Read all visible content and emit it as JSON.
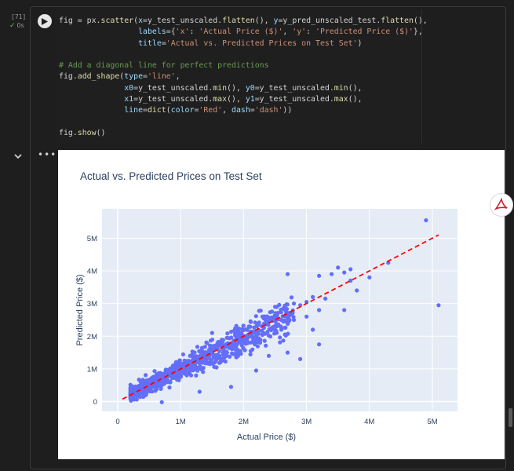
{
  "cell": {
    "execution_count": "[71]",
    "status_check": "✓",
    "status_time": "0s"
  },
  "code_lines": [
    [
      {
        "t": "fig = px.",
        "c": ""
      },
      {
        "t": "scatter",
        "c": "t-fn"
      },
      {
        "t": "(",
        "c": ""
      },
      {
        "t": "x",
        "c": "t-var"
      },
      {
        "t": "=y_test_unscaled.",
        "c": ""
      },
      {
        "t": "flatten",
        "c": "t-fn"
      },
      {
        "t": "(), ",
        "c": ""
      },
      {
        "t": "y",
        "c": "t-var"
      },
      {
        "t": "=y_pred_unscaled_test.",
        "c": ""
      },
      {
        "t": "flatten",
        "c": "t-fn"
      },
      {
        "t": "(),",
        "c": ""
      }
    ],
    [
      {
        "t": "                 ",
        "c": ""
      },
      {
        "t": "labels",
        "c": "t-var"
      },
      {
        "t": "={",
        "c": ""
      },
      {
        "t": "'x'",
        "c": "t-str"
      },
      {
        "t": ": ",
        "c": ""
      },
      {
        "t": "'Actual Price ($)'",
        "c": "t-str"
      },
      {
        "t": ", ",
        "c": ""
      },
      {
        "t": "'y'",
        "c": "t-str"
      },
      {
        "t": ": ",
        "c": ""
      },
      {
        "t": "'Predicted Price ($)'",
        "c": "t-str"
      },
      {
        "t": "},",
        "c": ""
      }
    ],
    [
      {
        "t": "                 ",
        "c": ""
      },
      {
        "t": "title",
        "c": "t-var"
      },
      {
        "t": "=",
        "c": ""
      },
      {
        "t": "'Actual vs. Predicted Prices on Test Set'",
        "c": "t-str"
      },
      {
        "t": ")",
        "c": ""
      }
    ],
    [
      {
        "t": "",
        "c": ""
      }
    ],
    [
      {
        "t": "# Add a diagonal line for perfect predictions",
        "c": "t-cmt"
      }
    ],
    [
      {
        "t": "fig.",
        "c": ""
      },
      {
        "t": "add_shape",
        "c": "t-fn"
      },
      {
        "t": "(",
        "c": ""
      },
      {
        "t": "type",
        "c": "t-var"
      },
      {
        "t": "=",
        "c": ""
      },
      {
        "t": "'line'",
        "c": "t-str"
      },
      {
        "t": ",",
        "c": ""
      }
    ],
    [
      {
        "t": "              ",
        "c": ""
      },
      {
        "t": "x0",
        "c": "t-var"
      },
      {
        "t": "=y_test_unscaled.",
        "c": ""
      },
      {
        "t": "min",
        "c": "t-fn"
      },
      {
        "t": "(), ",
        "c": ""
      },
      {
        "t": "y0",
        "c": "t-var"
      },
      {
        "t": "=y_test_unscaled.",
        "c": ""
      },
      {
        "t": "min",
        "c": "t-fn"
      },
      {
        "t": "(),",
        "c": ""
      }
    ],
    [
      {
        "t": "              ",
        "c": ""
      },
      {
        "t": "x1",
        "c": "t-var"
      },
      {
        "t": "=y_test_unscaled.",
        "c": ""
      },
      {
        "t": "max",
        "c": "t-fn"
      },
      {
        "t": "(), ",
        "c": ""
      },
      {
        "t": "y1",
        "c": "t-var"
      },
      {
        "t": "=y_test_unscaled.",
        "c": ""
      },
      {
        "t": "max",
        "c": "t-fn"
      },
      {
        "t": "(),",
        "c": ""
      }
    ],
    [
      {
        "t": "              ",
        "c": ""
      },
      {
        "t": "line",
        "c": "t-var"
      },
      {
        "t": "=",
        "c": ""
      },
      {
        "t": "dict",
        "c": "t-fn"
      },
      {
        "t": "(",
        "c": ""
      },
      {
        "t": "color",
        "c": "t-var"
      },
      {
        "t": "=",
        "c": ""
      },
      {
        "t": "'Red'",
        "c": "t-str"
      },
      {
        "t": ", ",
        "c": ""
      },
      {
        "t": "dash",
        "c": "t-var"
      },
      {
        "t": "=",
        "c": ""
      },
      {
        "t": "'dash'",
        "c": "t-str"
      },
      {
        "t": "))",
        "c": ""
      }
    ],
    [
      {
        "t": "",
        "c": ""
      }
    ],
    [
      {
        "t": "fig.",
        "c": ""
      },
      {
        "t": "show",
        "c": "t-fn"
      },
      {
        "t": "()",
        "c": ""
      }
    ]
  ],
  "output": {
    "more_label": "•••"
  },
  "chart_data": {
    "type": "scatter",
    "title": "Actual vs. Predicted Prices on Test Set",
    "xlabel": "Actual Price ($)",
    "ylabel": "Predicted Price ($)",
    "xlim": [
      -250000,
      5400000
    ],
    "ylim": [
      -300000,
      5900000
    ],
    "x_ticks": [
      0,
      1000000,
      2000000,
      3000000,
      4000000,
      5000000
    ],
    "x_tick_labels": [
      "0",
      "1M",
      "2M",
      "3M",
      "4M",
      "5M"
    ],
    "y_ticks": [
      0,
      1000000,
      2000000,
      3000000,
      4000000,
      5000000
    ],
    "y_tick_labels": [
      "0",
      "1M",
      "2M",
      "3M",
      "4M",
      "5M"
    ],
    "grid": true,
    "marker_color": "#636efa",
    "line_color": "#ff0000",
    "diagonal": {
      "x0": 75000,
      "y0": 75000,
      "x1": 5100000,
      "y1": 5100000
    },
    "points": [
      [
        4900000,
        5550000
      ],
      [
        5100000,
        2950000
      ],
      [
        4300000,
        4250000
      ],
      [
        3700000,
        4050000
      ],
      [
        3600000,
        3950000
      ],
      [
        3500000,
        4100000
      ],
      [
        3400000,
        3900000
      ],
      [
        3700000,
        3700000
      ],
      [
        3200000,
        3850000
      ],
      [
        2700000,
        3900000
      ],
      [
        3100000,
        3200000
      ],
      [
        3300000,
        3150000
      ],
      [
        3000000,
        3050000
      ],
      [
        2900000,
        2950000
      ],
      [
        3200000,
        2800000
      ],
      [
        3000000,
        2600000
      ],
      [
        2800000,
        2500000
      ],
      [
        3600000,
        2800000
      ],
      [
        3100000,
        2200000
      ],
      [
        3200000,
        1750000
      ],
      [
        2400000,
        1400000
      ],
      [
        1800000,
        450000
      ],
      [
        2200000,
        950000
      ],
      [
        1300000,
        300000
      ],
      [
        700000,
        -20000
      ],
      [
        2700000,
        1500000
      ],
      [
        2900000,
        1300000
      ],
      [
        2300000,
        2600000
      ],
      [
        2500000,
        2900000
      ],
      [
        1500000,
        2100000
      ],
      [
        4000000,
        3800000
      ],
      [
        3800000,
        3400000
      ],
      [
        2600000,
        2200000
      ],
      [
        2800000,
        3000000
      ]
    ]
  }
}
